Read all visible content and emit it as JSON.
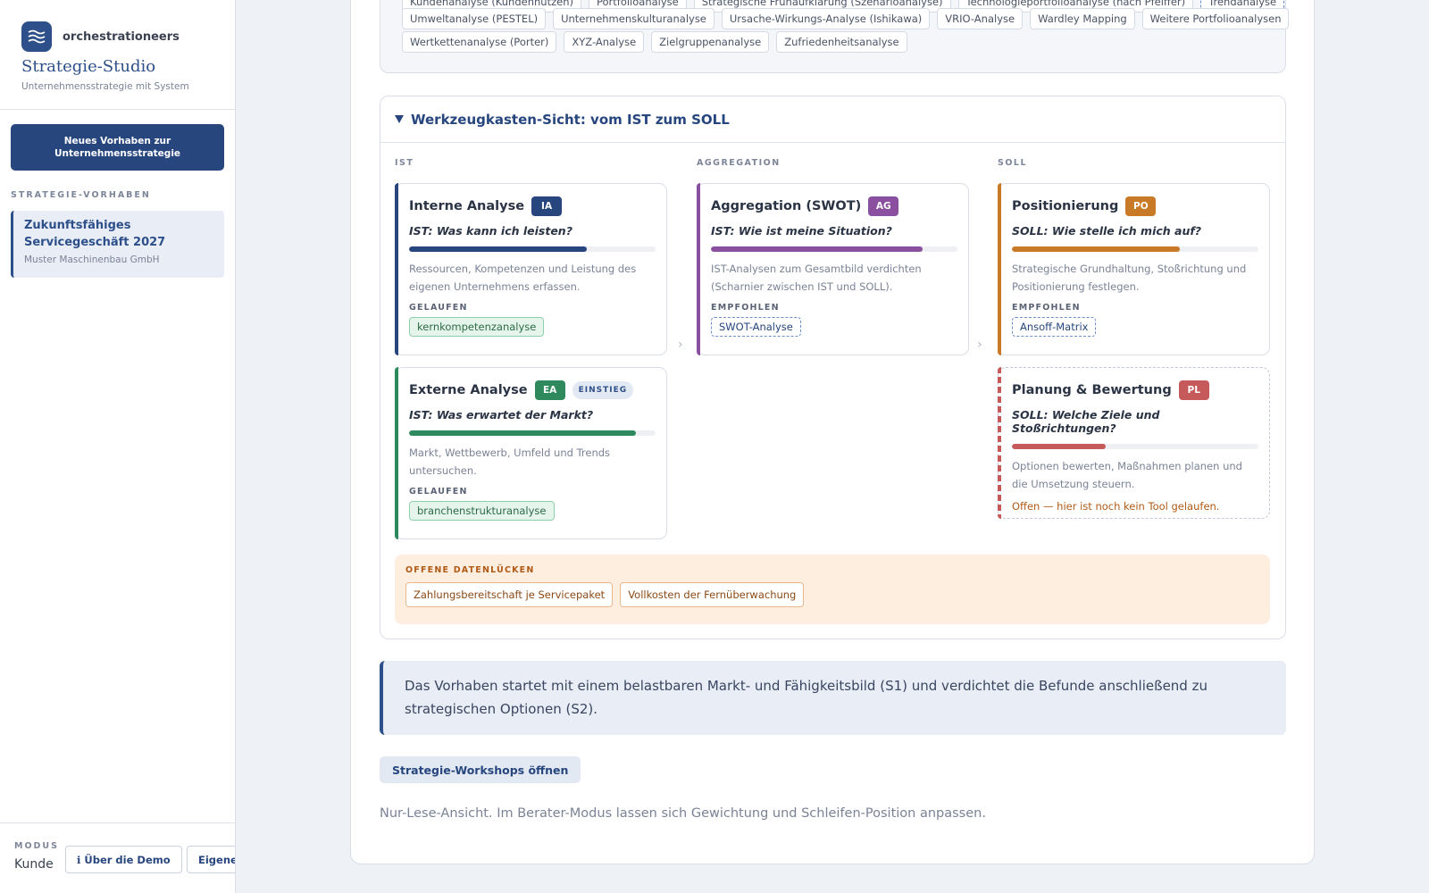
{
  "sidebar": {
    "brand": "orchestrationeers",
    "studio_title": "Strategie-Studio",
    "studio_subtitle": "Unternehmensstrategie mit System",
    "new_button": "Neues Vorhaben zur Unternehmensstrategie",
    "section_label": "STRATEGIE-VORHABEN",
    "project": {
      "title": "Zukunftsfähiges Servicegeschäft 2027",
      "company": "Muster Maschinenbau GmbH"
    },
    "mode_label": "MODUS",
    "mode_value": "Kunde",
    "about_button": "ℹ Über die Demo",
    "own_button": "Eigene"
  },
  "tool_chips": {
    "row0": [
      "Kundenanalyse (Kundennutzen)",
      "Portfolioanalyse",
      "Strategische Frühaufklärung (Szenarioanalyse)",
      "Technologieportfolioanalyse (nach Pfeiffer)",
      "Trendanalyse"
    ],
    "row1": [
      "Umweltanalyse (PESTEL)",
      "Unternehmenskulturanalyse",
      "Ursache-Wirkungs-Analyse (Ishikawa)",
      "VRIO-Analyse",
      "Wardley Mapping",
      "Weitere Portfolioanalysen"
    ],
    "row2": [
      "Wertkettenanalyse (Porter)",
      "XYZ-Analyse",
      "Zielgruppenanalyse",
      "Zufriedenheitsanalyse"
    ]
  },
  "toolbox": {
    "title": "Werkzeugkasten-Sicht: vom IST zum SOLL",
    "columns": [
      "IST",
      "AGGREGATION",
      "SOLL"
    ],
    "cards": {
      "ia": {
        "title": "Interne Analyse",
        "badge": "IA",
        "color": "#27467e",
        "question": "IST: Was kann ich leisten?",
        "progress": 0.72,
        "desc": "Ressourcen, Kompetenzen und Leistung des eigenen Unternehmens erfassen.",
        "sub_label": "GELAUFEN",
        "tool": "kernkompetenzanalyse"
      },
      "ea": {
        "title": "Externe Analyse",
        "badge": "EA",
        "badge2": "EINSTIEG",
        "color": "#2e8a5c",
        "question": "IST: Was erwartet der Markt?",
        "progress": 0.92,
        "desc": "Markt, Wettbewerb, Umfeld und Trends untersuchen.",
        "sub_label": "GELAUFEN",
        "tool": "branchenstrukturanalyse"
      },
      "ag": {
        "title": "Aggregation (SWOT)",
        "badge": "AG",
        "color": "#8a4f9e",
        "question": "IST: Wie ist meine Situation?",
        "progress": 0.86,
        "desc": "IST-Analysen zum Gesamtbild verdichten (Scharnier zwischen IST und SOLL).",
        "sub_label": "EMPFOHLEN",
        "tool": "SWOT-Analyse"
      },
      "po": {
        "title": "Positionierung",
        "badge": "PO",
        "color": "#c97a26",
        "question": "SOLL: Wie stelle ich mich auf?",
        "progress": 0.68,
        "desc": "Strategische Grundhaltung, Stoßrichtung und Positionierung festlegen.",
        "sub_label": "EMPFOHLEN",
        "tool": "Ansoff-Matrix"
      },
      "pl": {
        "title": "Planung & Bewertung",
        "badge": "PL",
        "color": "#c65a5a",
        "question": "SOLL: Welche Ziele und Stoßrichtungen?",
        "progress": 0.38,
        "desc": "Optionen bewerten, Maßnahmen planen und die Umsetzung steuern.",
        "open_note": "Offen — hier ist noch kein Tool gelaufen."
      }
    },
    "arrow_glyph": "›",
    "gaps_label": "OFFENE DATENLÜCKEN",
    "gaps": [
      "Zahlungsbereitschaft je Servicepaket",
      "Vollkosten der Fernüberwachung"
    ]
  },
  "callout": "Das Vorhaben startet mit einem belastbaren Markt- und Fähigkeitsbild (S1) und verdichtet die Befunde anschließend zu strategischen Optionen (S2).",
  "workshops_button": "Strategie-Workshops öffnen",
  "readonly_note": "Nur-Lese-Ansicht. Im Berater-Modus lassen sich Gewichtung und Schleifen-Position anpassen."
}
